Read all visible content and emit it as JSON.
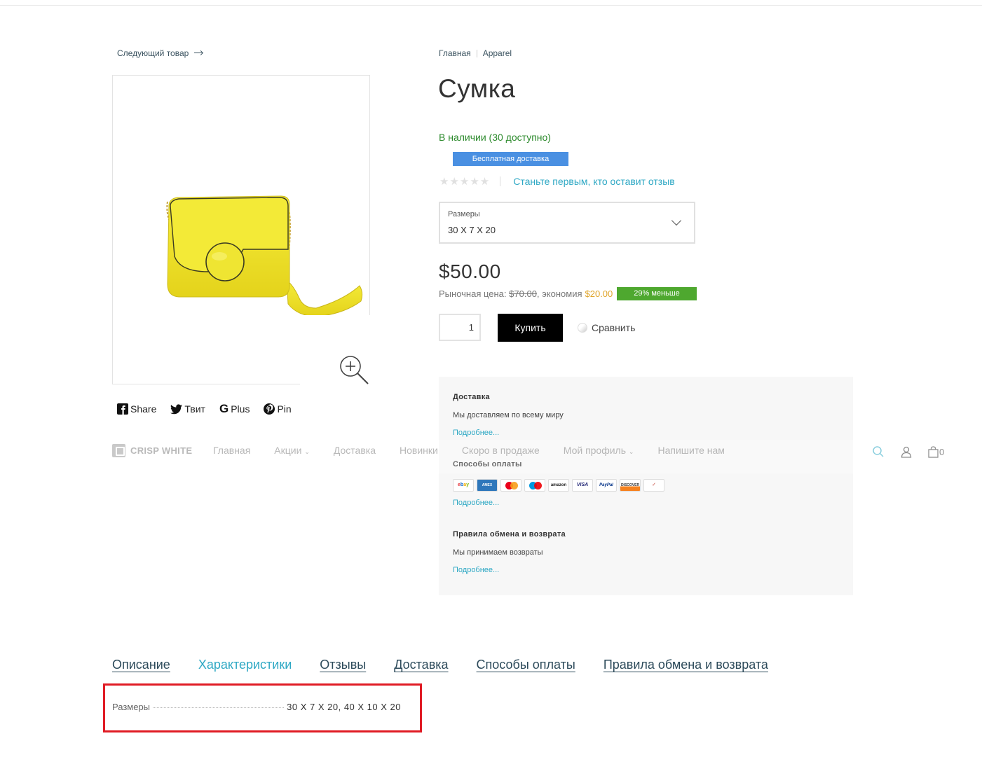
{
  "navigation": {
    "next_product": "Следующий товар"
  },
  "breadcrumb": [
    {
      "label": "Главная"
    },
    {
      "label": "Apparel"
    }
  ],
  "product": {
    "title": "Сумка",
    "stock": "В наличии (30 доступно)",
    "shipping_badge": "Бесплатная доставка",
    "rating": 0,
    "review_link": "Станьте первым, кто оставит отзыв",
    "select": {
      "label": "Размеры",
      "value": "30 X 7 X 20"
    },
    "price": "$50.00",
    "market_label": "Рыночная цена:",
    "market_price": "$70.00",
    "savings_label": ", экономия",
    "savings": "$20.00",
    "discount_badge": "29% меньше",
    "quantity": "1",
    "buy_button": "Купить",
    "compare": "Сравнить"
  },
  "share": {
    "facebook": "Share",
    "twitter": "Твит",
    "google": "Plus",
    "pinterest": "Pin"
  },
  "info_panel": {
    "delivery": {
      "title": "Доставка",
      "text": "Мы доставляем по всему миру",
      "link": "Подробнее..."
    },
    "payment": {
      "title": "Способы оплаты",
      "link": "Подробнее...",
      "icons": [
        "ebay",
        "american-express",
        "mastercard",
        "maestro",
        "amazon",
        "visa",
        "paypal",
        "discover",
        "other"
      ]
    },
    "returns": {
      "title": "Правила обмена и возврата",
      "text": "Мы принимаем возвраты",
      "link": "Подробнее..."
    }
  },
  "sticky_nav": {
    "logo": "CRISP WHITE",
    "items": [
      "Главная",
      "Акции",
      "Доставка",
      "Новинки",
      "Скоро в продаже",
      "Мой профиль",
      "Напишите нам"
    ],
    "cart_count": "0"
  },
  "tabs": [
    {
      "label": "Описание",
      "active": false
    },
    {
      "label": "Характеристики",
      "active": true
    },
    {
      "label": "Отзывы",
      "active": false
    },
    {
      "label": "Доставка",
      "active": false
    },
    {
      "label": "Способы оплаты",
      "active": false
    },
    {
      "label": "Правила обмена и возврата",
      "active": false
    }
  ],
  "specs": [
    {
      "label": "Размеры",
      "value": "30 X 7 X 20, 40 X 10 X 20"
    }
  ],
  "colors": {
    "accent": "#2ea8c4",
    "in_stock": "#2c8a2c",
    "badge_blue": "#4a90e2",
    "badge_green": "#4ea82f",
    "highlight_frame": "#e01b24"
  }
}
